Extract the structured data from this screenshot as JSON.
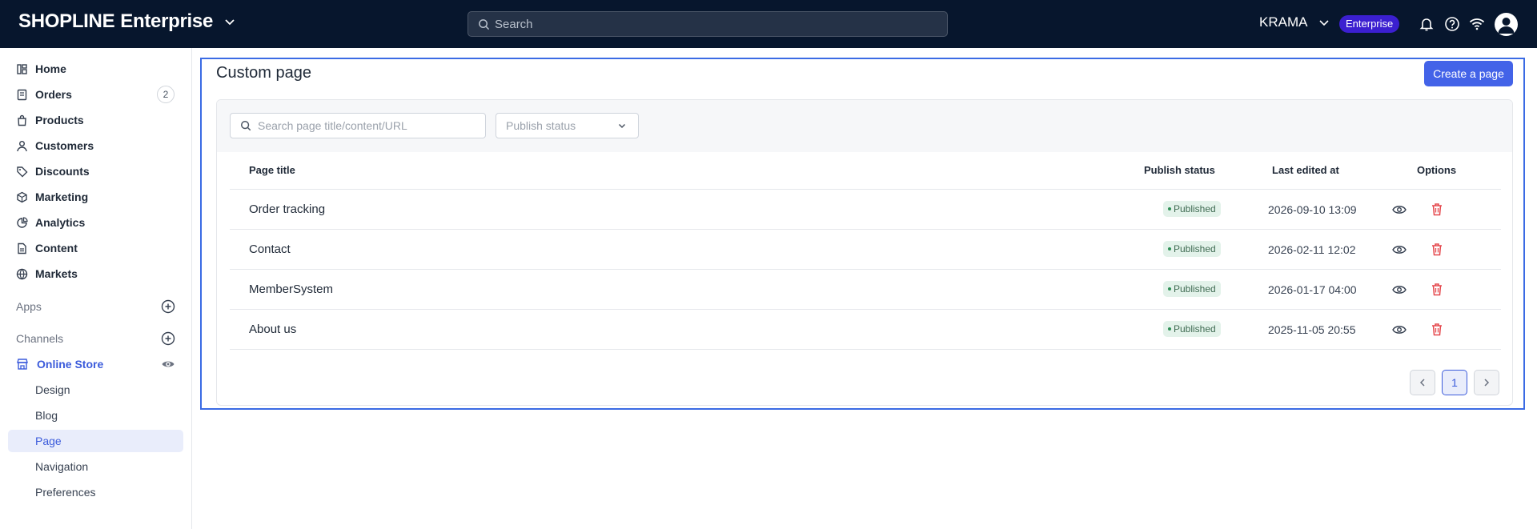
{
  "header": {
    "brand_primary": "SHOPLINE",
    "brand_secondary": "Enterprise",
    "search_placeholder": "Search",
    "store_name": "KRAMA",
    "plan_badge": "Enterprise",
    "icons": [
      "bell-icon",
      "help-icon",
      "wifi-icon",
      "avatar"
    ]
  },
  "sidebar": {
    "items": [
      {
        "label": "Home",
        "icon": "home-icon"
      },
      {
        "label": "Orders",
        "icon": "orders-icon",
        "count": "2"
      },
      {
        "label": "Products",
        "icon": "bag-icon"
      },
      {
        "label": "Customers",
        "icon": "user-icon"
      },
      {
        "label": "Discounts",
        "icon": "tag-icon"
      },
      {
        "label": "Marketing",
        "icon": "cube-icon"
      },
      {
        "label": "Analytics",
        "icon": "pie-icon"
      },
      {
        "label": "Content",
        "icon": "doc-icon"
      },
      {
        "label": "Markets",
        "icon": "globe-icon"
      }
    ],
    "apps_label": "Apps",
    "channels_label": "Channels",
    "online_store": {
      "label": "Online Store"
    },
    "sub_items": [
      {
        "label": "Design"
      },
      {
        "label": "Blog"
      },
      {
        "label": "Page",
        "active": true
      },
      {
        "label": "Navigation"
      },
      {
        "label": "Preferences"
      }
    ]
  },
  "main": {
    "title": "Custom page",
    "create_button": "Create a page",
    "filter": {
      "search_placeholder": "Search page title/content/URL",
      "status_placeholder": "Publish status"
    },
    "columns": [
      "Page title",
      "Publish status",
      "Last edited at",
      "Options"
    ],
    "rows": [
      {
        "title": "Order tracking",
        "status": "Published",
        "edited": "2026-09-10 13:09"
      },
      {
        "title": "Contact",
        "status": "Published",
        "edited": "2026-02-11 12:02"
      },
      {
        "title": "MemberSystem",
        "status": "Published",
        "edited": "2026-01-17 04:00"
      },
      {
        "title": "About us",
        "status": "Published",
        "edited": "2025-11-05 20:55"
      }
    ],
    "pagination": {
      "current_page": "1"
    }
  },
  "colors": {
    "topbar_bg": "#07162d",
    "accent": "#4363e8",
    "enterprise_badge": "#3b1fd0",
    "published_bg": "#e3f2ea",
    "delete_icon": "#e5484d"
  }
}
